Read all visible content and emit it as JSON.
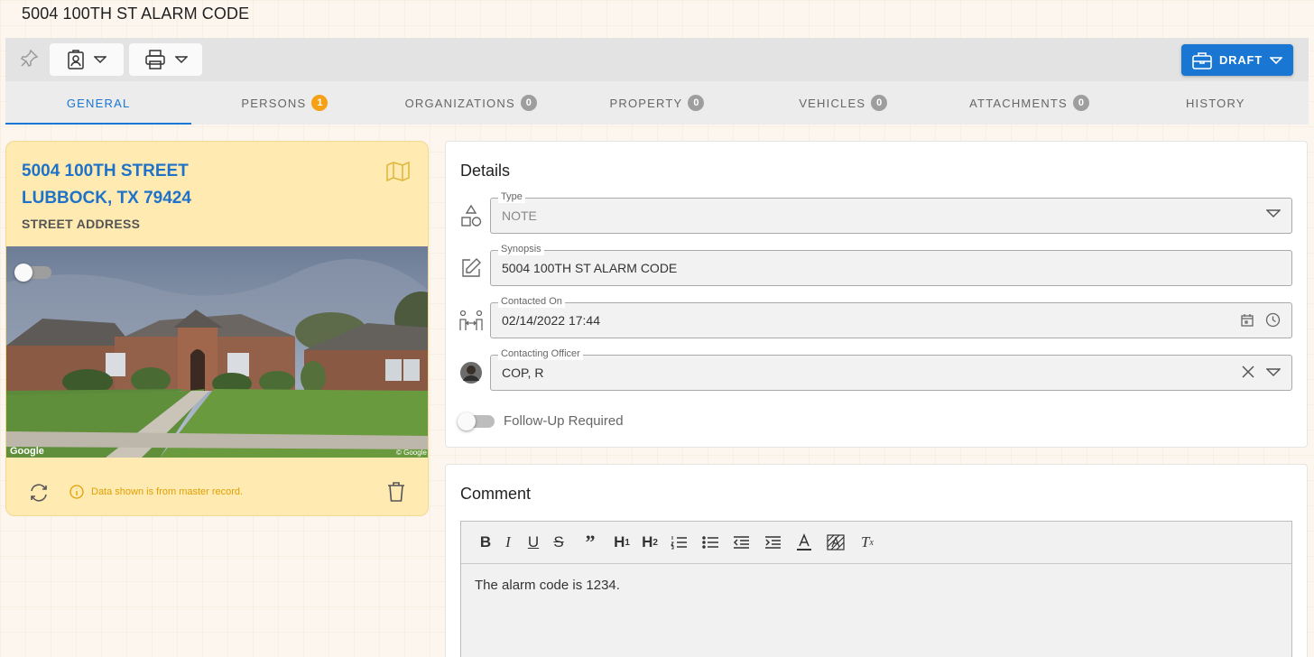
{
  "page": {
    "title": "5004 100TH ST ALARM CODE"
  },
  "toolbar": {
    "draft_label": "DRAFT"
  },
  "tabs": [
    {
      "label": "GENERAL",
      "count": null
    },
    {
      "label": "PERSONS",
      "count": "1"
    },
    {
      "label": "ORGANIZATIONS",
      "count": "0"
    },
    {
      "label": "PROPERTY",
      "count": "0"
    },
    {
      "label": "VEHICLES",
      "count": "0"
    },
    {
      "label": "ATTACHMENTS",
      "count": "0"
    },
    {
      "label": "HISTORY",
      "count": null
    }
  ],
  "address_card": {
    "line1": "5004 100TH STREET",
    "line2": "LUBBOCK, TX 79424",
    "type": "STREET ADDRESS",
    "photo_watermark_left": "Google",
    "photo_watermark_right": "© Google",
    "note": "Data shown is from master record."
  },
  "details": {
    "title": "Details",
    "type": {
      "label": "Type",
      "value": "NOTE"
    },
    "synopsis": {
      "label": "Synopsis",
      "value": "5004 100TH ST ALARM CODE"
    },
    "contacted_on": {
      "label": "Contacted On",
      "value": "02/14/2022 17:44"
    },
    "contacting_officer": {
      "label": "Contacting Officer",
      "value": "COP, R"
    },
    "follow_up_label": "Follow-Up Required"
  },
  "comment": {
    "title": "Comment",
    "body": "The alarm code is 1234."
  },
  "colors": {
    "accent": "#1976d2",
    "badge_orange": "#f5a015",
    "card_yellow": "#ffeab2"
  }
}
